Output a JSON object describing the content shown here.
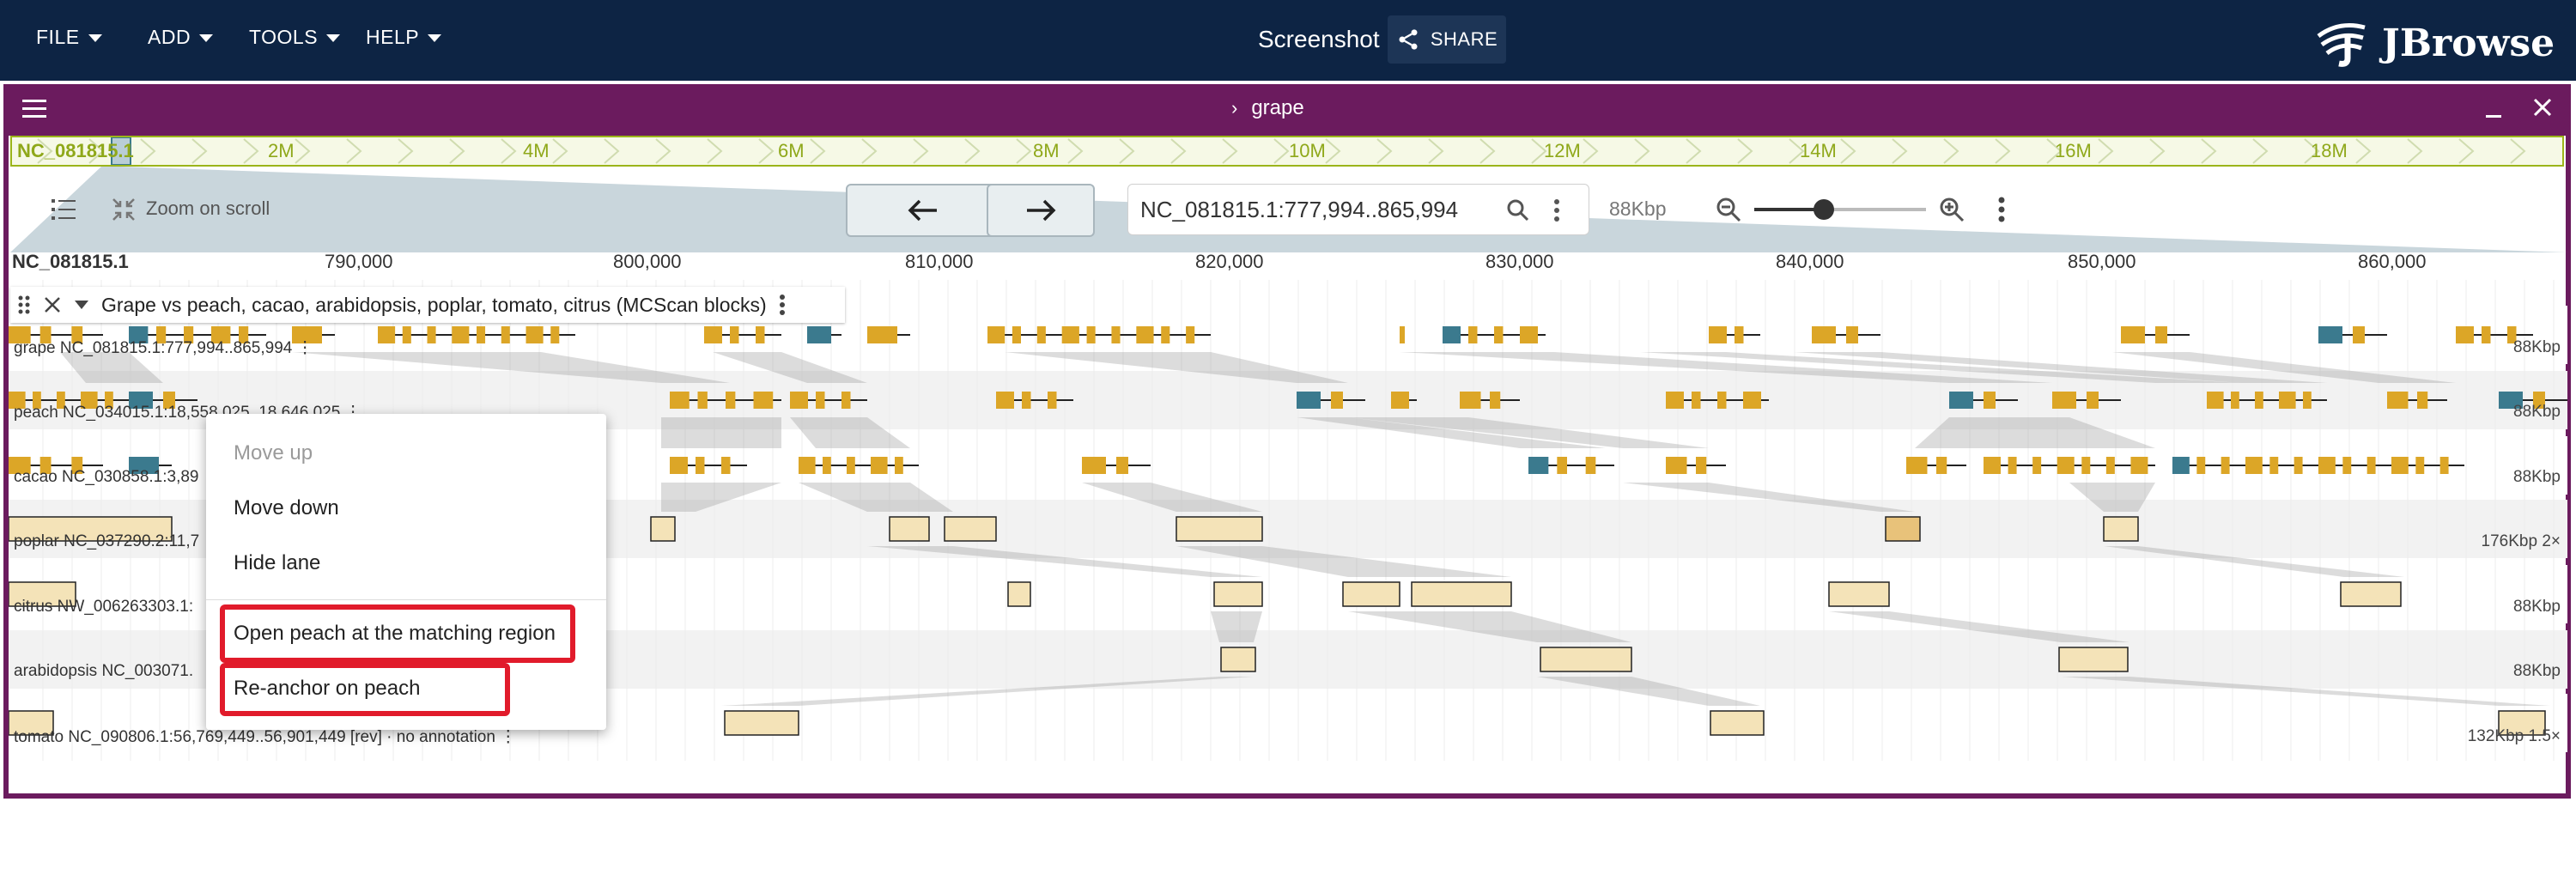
{
  "menu": {
    "file": "FILE",
    "add": "ADD",
    "tools": "TOOLS",
    "help": "HELP"
  },
  "session_title": "Screenshot",
  "share_label": "SHARE",
  "logo_text": "JBrowse",
  "view": {
    "title": "grape",
    "overview_ref": "NC_081815.1",
    "overview_ticks": [
      "2M",
      "4M",
      "6M",
      "8M",
      "10M",
      "12M",
      "14M",
      "16M",
      "18M"
    ],
    "zoom_on_scroll": "Zoom on scroll",
    "location": "NC_081815.1:777,994..865,994",
    "span": "88Kbp",
    "ruler_ref": "NC_081815.1",
    "ruler_ticks": [
      "790,000",
      "800,000",
      "810,000",
      "820,000",
      "830,000",
      "840,000",
      "850,000",
      "860,000"
    ]
  },
  "track": {
    "name": "Grape vs peach, cacao, arabidopsis, poplar, tomato, citrus (MCScan blocks)"
  },
  "lanes": [
    {
      "label": "grape NC_081815.1:777,994..865,994 ⋮",
      "right": "88Kbp"
    },
    {
      "label": "peach NC_034015.1:18,558,025..18,646,025 ⋮",
      "right": "88Kbp"
    },
    {
      "label": "cacao NC_030858.1:3,89",
      "right": "88Kbp"
    },
    {
      "label": "poplar NC_037290.2:11,7",
      "right": "176Kbp 2×"
    },
    {
      "label": "citrus NW_006263303.1:",
      "right": "88Kbp"
    },
    {
      "label": "arabidopsis NC_003071.",
      "right": "88Kbp"
    },
    {
      "label": "tomato NC_090806.1:56,769,449..56,901,449 [rev] · no annotation ⋮",
      "right": "132Kbp 1.5×"
    }
  ],
  "context_menu": {
    "move_up": "Move up",
    "move_down": "Move down",
    "hide_lane": "Hide lane",
    "open_region": "Open peach at the matching region",
    "reanchor": "Re-anchor on peach"
  },
  "colors": {
    "appbar": "#0d2444",
    "view_frame": "#6b1b5e",
    "gene_yellow": "#dca627",
    "gene_teal": "#3b7a8e",
    "block_fill": "#f4e3b8",
    "highlight": "#e11b2b"
  }
}
